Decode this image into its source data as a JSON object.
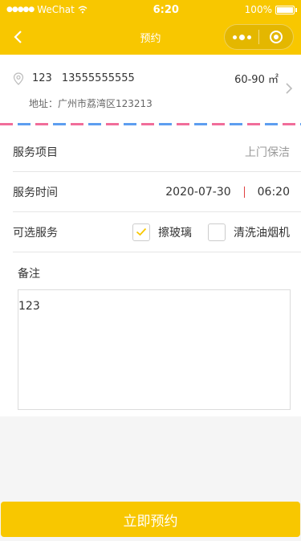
{
  "status_bar": {
    "carrier": "WeChat",
    "time": "6:20",
    "battery": "100%"
  },
  "nav": {
    "title": "预约"
  },
  "address": {
    "name": "123",
    "phone": "13555555555",
    "area": "60-90 ㎡",
    "detail": "地址：广州市荔湾区123213"
  },
  "form": {
    "service_label": "服务项目",
    "service_value": "上门保洁",
    "time_label": "服务时间",
    "date": "2020-07-30",
    "time": "06:20",
    "options_label": "可选服务",
    "options": [
      {
        "label": "擦玻璃",
        "checked": true
      },
      {
        "label": "清洗油烟机",
        "checked": false
      }
    ],
    "remark_label": "备注",
    "remark_value": "123"
  },
  "submit": {
    "label": "立即预约"
  },
  "colors": {
    "accent": "#f8c700",
    "stripe_pink": "#f16d9a",
    "stripe_blue": "#5d9ef0"
  },
  "icons": {
    "back": "chevron-left-icon",
    "pin": "location-pin-icon",
    "arrow": "chevron-right-icon",
    "more": "more-dots-icon",
    "close": "circle-target-icon",
    "check": "checkmark-icon"
  }
}
